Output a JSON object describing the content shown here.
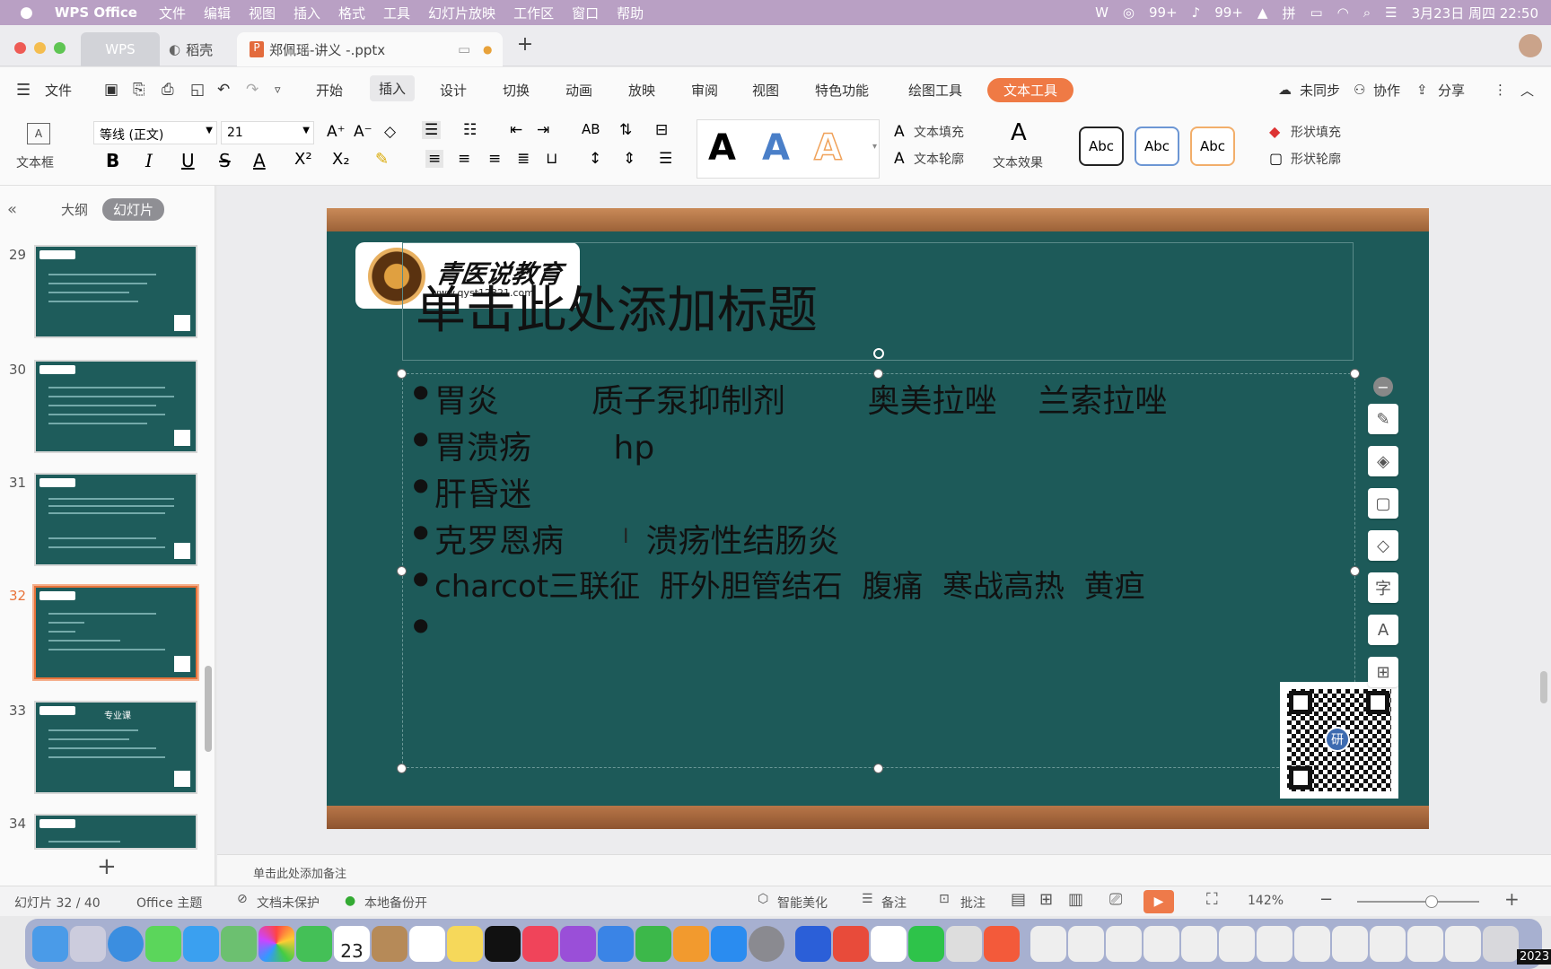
{
  "macbar": {
    "app": "WPS Office",
    "menus": [
      "文件",
      "编辑",
      "视图",
      "插入",
      "格式",
      "工具",
      "幻灯片放映",
      "工作区",
      "窗口",
      "帮助"
    ],
    "wechat_badge": "99+",
    "qq_badge": "99+",
    "datetime": "3月23日 周四  22:50"
  },
  "tabs": {
    "wps": "WPS",
    "daoke": "稻壳",
    "doc": "郑佩瑶-讲义 -.pptx"
  },
  "menubar": {
    "file": "文件",
    "items": [
      "开始",
      "插入",
      "设计",
      "切换",
      "动画",
      "放映",
      "审阅",
      "视图",
      "特色功能",
      "绘图工具",
      "文本工具"
    ],
    "active": "文本工具",
    "sync": "未同步",
    "collab": "协作",
    "share": "分享"
  },
  "ribbon": {
    "textbox": "文本框",
    "font_name": "等线 (正文)",
    "font_size": "21",
    "styles": [
      "A",
      "A",
      "A"
    ],
    "text_fill": "文本填充",
    "text_outline": "文本轮廓",
    "text_effect": "文本效果",
    "shape_styles": [
      "Abc",
      "Abc",
      "Abc"
    ],
    "shape_fill": "形状填充",
    "shape_outline": "形状轮廓"
  },
  "sidebar": {
    "outline": "大纲",
    "slides": "幻灯片",
    "thumbs": [
      {
        "num": "29"
      },
      {
        "num": "30"
      },
      {
        "num": "31"
      },
      {
        "num": "32"
      },
      {
        "num": "33",
        "title": "专业课"
      },
      {
        "num": "34"
      }
    ],
    "add": "+"
  },
  "slide": {
    "logo_name": "青医说教育",
    "logo_url": "www.qyst12321.com",
    "title_placeholder": "单击此处添加标题",
    "bullets": [
      "胃炎         质子泵抑制剂        奥美拉唑    兰索拉唑",
      "胃溃疡        hp",
      "肝昏迷",
      "克罗恩病        溃疡性结肠炎",
      "charcot三联征  肝外胆管结石  腹痛  寒战高热  黄疸",
      ""
    ],
    "qr_center": "研"
  },
  "notes": "单击此处添加备注",
  "status": {
    "slide_info": "幻灯片 32 / 40",
    "theme": "Office 主题",
    "protect": "文档未保护",
    "backup": "本地备份开",
    "beautify": "智能美化",
    "notes": "备注",
    "comment": "批注",
    "zoom": "142%"
  },
  "dock": {
    "calendar_day": "23",
    "year_corner": "2023"
  }
}
